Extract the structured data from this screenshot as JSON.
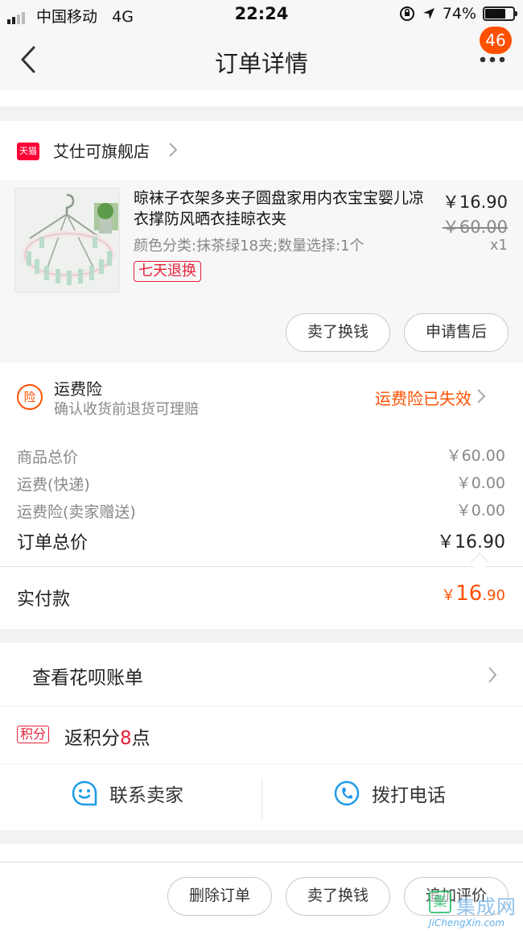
{
  "status_bar": {
    "carrier": "中国移动",
    "network": "4G",
    "time": "22:24",
    "battery_percent": "74%",
    "battery_level": 0.74
  },
  "nav": {
    "title": "订单详情",
    "badge_count": "46",
    "more_icon": "ellipsis-icon",
    "back_icon": "chevron-left-icon"
  },
  "shop": {
    "badge_text": "天猫",
    "name": "艾仕可旗舰店"
  },
  "item": {
    "title": "晾袜子衣架多夹子圆盘家用内衣宝宝婴儿凉衣撑防风晒衣挂晾衣夹",
    "sku": "颜色分类:抹茶绿18夹;数量选择:1个",
    "tag": "七天退换",
    "price": "￥16.90",
    "original_price": "￥60.00",
    "quantity": "x1",
    "actions": [
      "卖了换钱",
      "申请售后"
    ]
  },
  "insurance": {
    "icon_text": "险",
    "title": "运费险",
    "subtitle": "确认收货前退货可理赔",
    "status": "运费险已失效"
  },
  "fees": [
    {
      "label": "商品总价",
      "value": "￥60.00"
    },
    {
      "label": "运费(快递)",
      "value": "￥0.00"
    },
    {
      "label": "运费险(卖家赠送)",
      "value": "￥0.00"
    }
  ],
  "total": {
    "label": "订单总价",
    "value": "￥16.90"
  },
  "paid": {
    "label": "实付款",
    "currency": "￥",
    "integer": "16",
    "decimal": ".90"
  },
  "huabei": {
    "label": "查看花呗账单"
  },
  "points": {
    "tag": "积分",
    "prefix": "返积分",
    "count": "8",
    "suffix": "点"
  },
  "contact": {
    "seller_label": "联系卖家",
    "phone_label": "拨打电话"
  },
  "bottom_actions": [
    "删除订单",
    "卖了换钱",
    "追加评价"
  ],
  "watermark": {
    "icon_char": "集",
    "cn": "集成网",
    "en": "JiChengXin.com"
  },
  "colors": {
    "accent": "#ff5000",
    "tmall_red": "#ff0036",
    "tag_red": "#e6213a",
    "contact_blue": "#1e9be8"
  }
}
